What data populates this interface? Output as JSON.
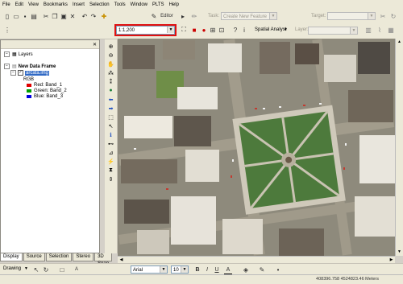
{
  "menu": [
    "File",
    "Edit",
    "View",
    "Bookmarks",
    "Insert",
    "Selection",
    "Tools",
    "Window",
    "PLTS",
    "Help"
  ],
  "editor": {
    "editor_label": "Editor",
    "task_label": "Task:",
    "task_value": "Create New Feature",
    "target_label": "Target:",
    "target_value": ""
  },
  "standard": {
    "scale_value": "1:1,200",
    "spatial_analyst_label": "Spatial Analyst",
    "layer_label": "Layer:",
    "layer_value": ""
  },
  "toc": {
    "root_label": "Layers",
    "frame_label": "New Data Frame",
    "layer_name": "arcata.img",
    "rgb_label": "RGB",
    "bands": [
      {
        "label": "Red:  Band_1",
        "color": "#e00000"
      },
      {
        "label": "Green:  Band_2",
        "color": "#00a000"
      },
      {
        "label": "Blue:  Band_3",
        "color": "#0000e0"
      }
    ]
  },
  "tabs": [
    "Display",
    "Source",
    "Selection",
    "Stereo",
    "3D Snap"
  ],
  "drawing": {
    "drawing_label": "Drawing",
    "font_name": "Arial",
    "font_size": "10",
    "bold": "B",
    "italic": "I",
    "underline": "U",
    "font_color_letter": "A"
  },
  "status": {
    "coords": "408396.758  4524823.46 Meters"
  },
  "colors": {
    "highlight_box": "#e01010",
    "selection_blue": "#316ac5"
  }
}
